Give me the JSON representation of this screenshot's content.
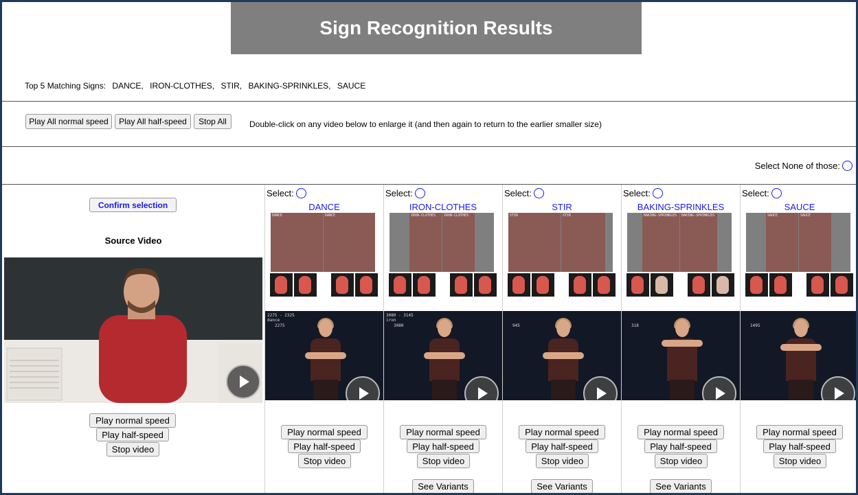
{
  "title": "Sign Recognition Results",
  "top_matches": {
    "label": "Top 5 Matching Signs:",
    "items": [
      "DANCE,",
      "IRON-CLOTHES,",
      "STIR,",
      "BAKING-SPRINKLES,",
      "SAUCE"
    ]
  },
  "controls": {
    "play_all_normal": "Play All normal speed",
    "play_all_half": "Play All half-speed",
    "stop_all": "Stop All",
    "hint": "Double-click on any video below to enlarge it (and then again to return to the earlier smaller size)"
  },
  "select_none_label": "Select None of those:",
  "source": {
    "confirm_label": "Confirm selection",
    "heading": "Source Video",
    "play_normal": "Play normal speed",
    "play_half": "Play half-speed",
    "stop": "Stop video"
  },
  "select_label": "Select:",
  "candidates": [
    {
      "name": "DANCE",
      "thumb_label": "DANCE",
      "timecode": "2275 - 2325",
      "tag": "dance",
      "frame": "2275",
      "play_normal": "Play normal speed",
      "play_half": "Play half-speed",
      "stop": "Stop video",
      "variants": ""
    },
    {
      "name": "IRON-CLOTHES",
      "thumb_label": "IRON-CLOTHES",
      "timecode": "3080 - 3145",
      "tag": "iron",
      "frame": "3080",
      "play_normal": "Play normal speed",
      "play_half": "Play half-speed",
      "stop": "Stop video",
      "variants": "See Variants"
    },
    {
      "name": "STIR",
      "thumb_label": "STIR",
      "timecode": "",
      "tag": "",
      "frame": "945",
      "play_normal": "Play normal speed",
      "play_half": "Play half-speed",
      "stop": "Stop video",
      "variants": "See Variants"
    },
    {
      "name": "BAKING-SPRINKLES",
      "thumb_label": "BAKING-SPRINKLES",
      "timecode": "",
      "tag": "",
      "frame": "318",
      "play_normal": "Play normal speed",
      "play_half": "Play half-speed",
      "stop": "Stop video",
      "variants": "See Variants"
    },
    {
      "name": "SAUCE",
      "thumb_label": "SAUCE",
      "timecode": "",
      "tag": "",
      "frame": "1495",
      "play_normal": "Play normal speed",
      "play_half": "Play half-speed",
      "stop": "Stop video",
      "variants": ""
    }
  ],
  "colors": {
    "link_blue": "#1a1aee",
    "title_bg": "#7f7f7f",
    "frame_border": "#1f3a5c"
  },
  "icons": {
    "play": "play-icon",
    "radio": "radio-button"
  }
}
